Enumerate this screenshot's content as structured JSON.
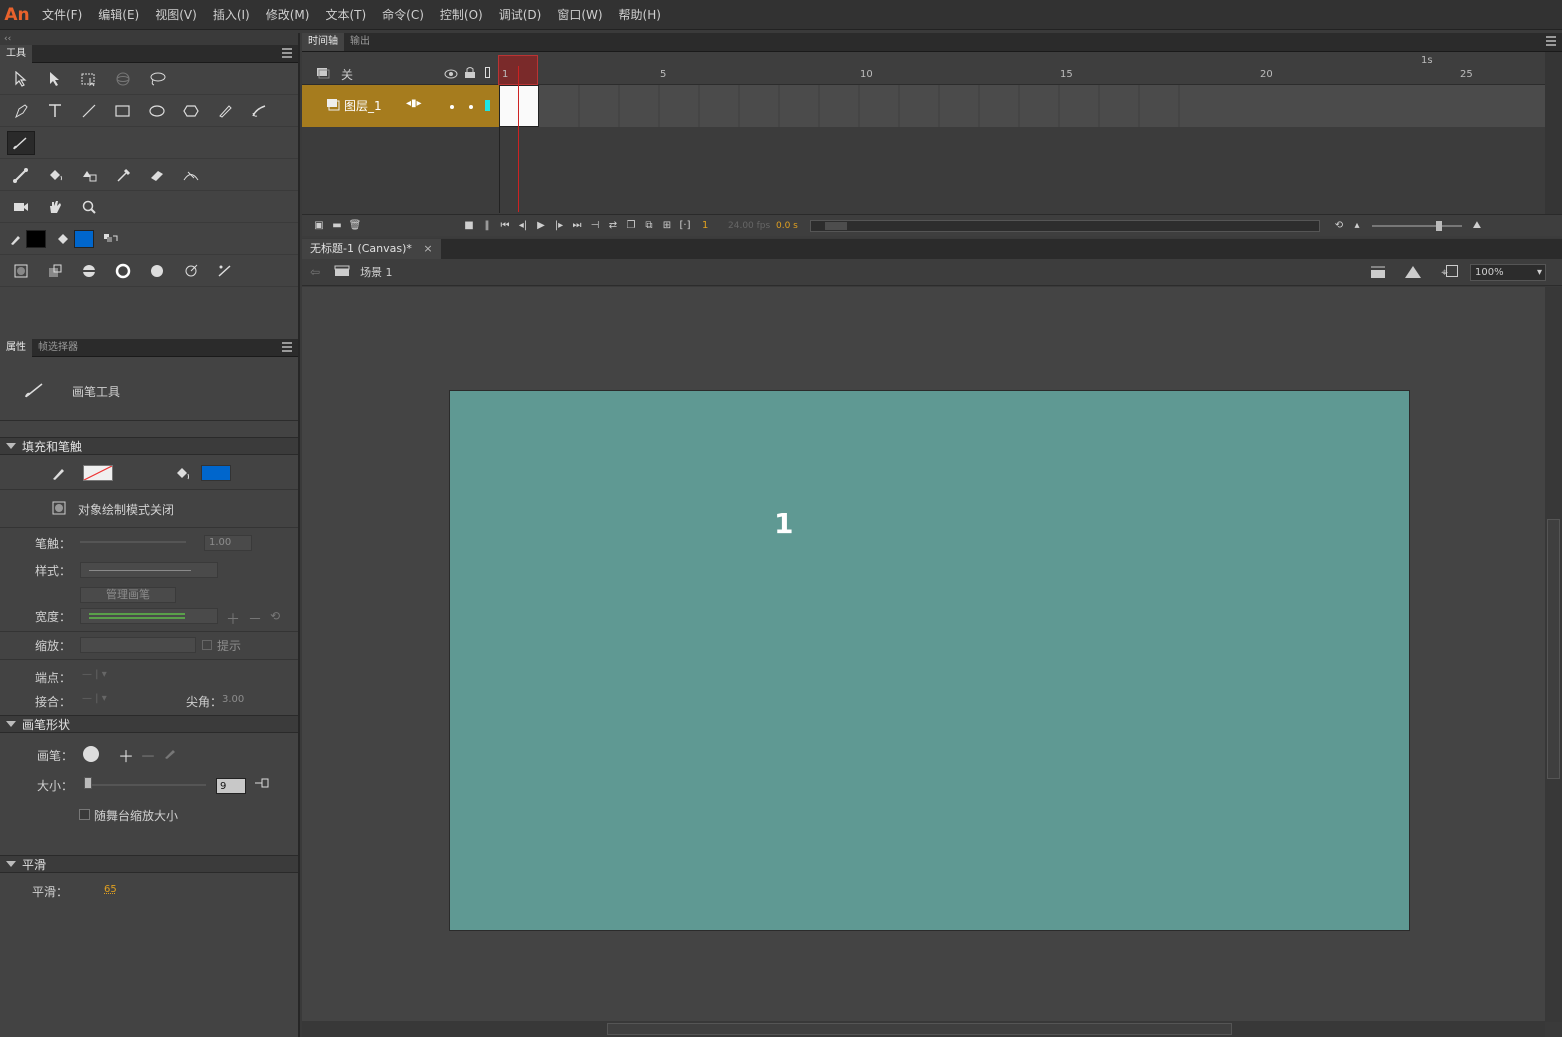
{
  "app": {
    "logo": "An"
  },
  "menu": [
    "文件(F)",
    "编辑(E)",
    "视图(V)",
    "插入(I)",
    "修改(M)",
    "文本(T)",
    "命令(C)",
    "控制(O)",
    "调试(D)",
    "窗口(W)",
    "帮助(H)"
  ],
  "tools_panel": {
    "tab": "工具",
    "collapse": "‹‹"
  },
  "properties_panel": {
    "tabs": [
      "属性",
      "帧选择器"
    ],
    "tool_name": "画笔工具",
    "fill_stroke": {
      "title": "填充和笔触",
      "fill_color": "#0066cc",
      "object_draw_mode": "对象绘制模式关闭",
      "stroke_label": "笔触：",
      "stroke_value": "1.00",
      "style_label": "样式：",
      "manage_brush": "管理画笔",
      "width_label": "宽度：",
      "scale_label": "缩放：",
      "hint_label": "提示",
      "cap_label": "端点：",
      "join_label": "接合：",
      "miter_label": "尖角：",
      "miter_value": "3.00"
    },
    "brush_shape": {
      "title": "画笔形状",
      "brush_label": "画笔：",
      "size_label": "大小：",
      "size_value": "9",
      "scale_with_stage": "随舞台缩放大小"
    },
    "smoothing": {
      "title": "平滑",
      "label": "平滑：",
      "value": "65"
    }
  },
  "timeline": {
    "tabs": [
      "时间轴",
      "输出"
    ],
    "onion_label": "关",
    "ruler": [
      "1",
      "5",
      "10",
      "15",
      "20",
      "25"
    ],
    "seconds_marker": "1s",
    "layer_name": "图层_1",
    "current_frame": "1",
    "fps": "24.00 fps",
    "time": "0.0 s"
  },
  "document": {
    "tab": "无标题-1 (Canvas)*",
    "close": "×",
    "scene": "场景 1",
    "zoom": "100%",
    "canvas_color": "#5f9993",
    "stage_text": "1"
  }
}
